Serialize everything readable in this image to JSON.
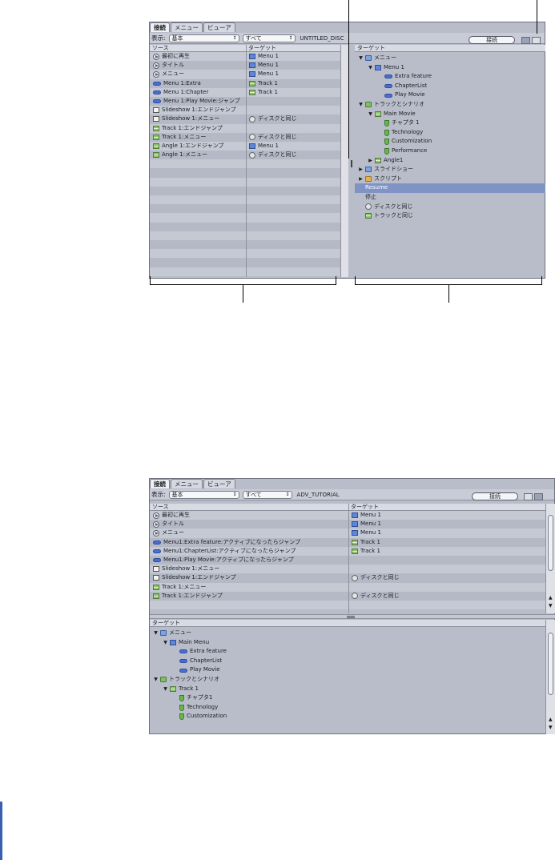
{
  "panel1": {
    "tabs": [
      "接続",
      "メニュー",
      "ビューア"
    ],
    "show_label": "表示:",
    "popup_basic": "基本",
    "popup_all": "すべて",
    "disc_name": "UNTITLED_DISC",
    "connect_button": "接続",
    "source_header": "ソース",
    "target_header": "ターゲット",
    "rows": [
      {
        "src_icon": "play",
        "src": "最初に再生",
        "tgt_icon": "menu",
        "tgt": "Menu 1"
      },
      {
        "src_icon": "play",
        "src": "タイトル",
        "tgt_icon": "menu",
        "tgt": "Menu 1"
      },
      {
        "src_icon": "play",
        "src": "メニュー",
        "tgt_icon": "menu",
        "tgt": "Menu 1"
      },
      {
        "src_icon": "btn",
        "src": "Menu 1:Extra",
        "tgt_icon": "track",
        "tgt": "Track 1"
      },
      {
        "src_icon": "btn",
        "src": "Menu 1:Chapter",
        "tgt_icon": "track",
        "tgt": "Track 1"
      },
      {
        "src_icon": "btn",
        "src": "Menu 1:Play Movie:ジャンプ",
        "tgt_icon": "",
        "tgt": ""
      },
      {
        "src_icon": "slide",
        "src": "Slideshow 1:エンドジャンプ",
        "tgt_icon": "",
        "tgt": ""
      },
      {
        "src_icon": "slide",
        "src": "Slideshow 1:メニュー",
        "tgt_icon": "disc",
        "tgt": "ディスクと同じ"
      },
      {
        "src_icon": "track",
        "src": "Track 1:エンドジャンプ",
        "tgt_icon": "",
        "tgt": ""
      },
      {
        "src_icon": "track",
        "src": "Track 1:メニュー",
        "tgt_icon": "disc",
        "tgt": "ディスクと同じ"
      },
      {
        "src_icon": "track",
        "src": "Angle 1:エンドジャンプ",
        "tgt_icon": "menu",
        "tgt": "Menu 1"
      },
      {
        "src_icon": "track",
        "src": "Angle 1:メニュー",
        "tgt_icon": "disc",
        "tgt": "ディスクと同じ"
      }
    ],
    "target_pane_header": "ターゲット",
    "tree": [
      {
        "indent": 0,
        "tri": "down",
        "icon": "folder-b",
        "label": "メニュー"
      },
      {
        "indent": 1,
        "tri": "down",
        "icon": "menu",
        "label": "Menu 1"
      },
      {
        "indent": 2,
        "tri": "",
        "icon": "btn",
        "label": "Extra feature"
      },
      {
        "indent": 2,
        "tri": "",
        "icon": "btn",
        "label": "ChapterList"
      },
      {
        "indent": 2,
        "tri": "",
        "icon": "btn",
        "label": "Play Movie"
      },
      {
        "indent": 0,
        "tri": "down",
        "icon": "folder-g",
        "label": "トラックとシナリオ"
      },
      {
        "indent": 1,
        "tri": "down",
        "icon": "track",
        "label": "Main Movie"
      },
      {
        "indent": 2,
        "tri": "",
        "icon": "chap",
        "label": "チャプタ 1"
      },
      {
        "indent": 2,
        "tri": "",
        "icon": "chap",
        "label": "Technology"
      },
      {
        "indent": 2,
        "tri": "",
        "icon": "chap",
        "label": "Customization"
      },
      {
        "indent": 2,
        "tri": "",
        "icon": "chap",
        "label": "Performance"
      },
      {
        "indent": 1,
        "tri": "right",
        "icon": "track",
        "label": "Angle1"
      },
      {
        "indent": 0,
        "tri": "right",
        "icon": "folder-b",
        "label": "スライドショー"
      },
      {
        "indent": 0,
        "tri": "right",
        "icon": "folder-o",
        "label": "スクリプト"
      },
      {
        "indent": 0,
        "tri": "",
        "icon": "",
        "label": "Resume",
        "selected": true
      },
      {
        "indent": 0,
        "tri": "",
        "icon": "",
        "label": "停止"
      },
      {
        "indent": 0,
        "tri": "",
        "icon": "disc",
        "label": "ディスクと同じ"
      },
      {
        "indent": 0,
        "tri": "",
        "icon": "track",
        "label": "トラックと同じ"
      }
    ]
  },
  "panel2": {
    "tabs": [
      "接続",
      "メニュー",
      "ビューア"
    ],
    "show_label": "表示:",
    "popup_basic": "基本",
    "popup_all": "すべて",
    "disc_name": "ADV_TUTORIAL",
    "connect_button": "接続",
    "source_header": "ソース",
    "target_header": "ターゲット",
    "rows": [
      {
        "src_icon": "play",
        "src": "最初に再生",
        "tgt_icon": "menu",
        "tgt": "Menu 1"
      },
      {
        "src_icon": "play",
        "src": "タイトル",
        "tgt_icon": "menu",
        "tgt": "Menu 1"
      },
      {
        "src_icon": "play",
        "src": "メニュー",
        "tgt_icon": "menu",
        "tgt": "Menu 1"
      },
      {
        "src_icon": "btn",
        "src": "Menu1:Extra feature:アクティブになったらジャンプ",
        "tgt_icon": "track",
        "tgt": "Track 1"
      },
      {
        "src_icon": "btn",
        "src": "Menu1:ChapterList:アクティブになったらジャンプ",
        "tgt_icon": "track",
        "tgt": "Track 1"
      },
      {
        "src_icon": "btn",
        "src": "Menu1:Play Movie:アクティブになったらジャンプ",
        "tgt_icon": "",
        "tgt": ""
      },
      {
        "src_icon": "slide",
        "src": "Slideshow 1:メニュー",
        "tgt_icon": "",
        "tgt": ""
      },
      {
        "src_icon": "slide",
        "src": "Slideshow 1:エンドジャンプ",
        "tgt_icon": "disc",
        "tgt": "ディスクと同じ"
      },
      {
        "src_icon": "track",
        "src": "Track 1:メニュー",
        "tgt_icon": "",
        "tgt": ""
      },
      {
        "src_icon": "track",
        "src": "Track 1:エンドジャンプ",
        "tgt_icon": "disc",
        "tgt": "ディスクと同じ"
      }
    ],
    "target_pane_header": "ターゲット",
    "tree": [
      {
        "indent": 0,
        "tri": "down",
        "icon": "folder-b",
        "label": "メニュー"
      },
      {
        "indent": 1,
        "tri": "down",
        "icon": "menu",
        "label": "Main Menu"
      },
      {
        "indent": 2,
        "tri": "",
        "icon": "btn",
        "label": "Extra feature"
      },
      {
        "indent": 2,
        "tri": "",
        "icon": "btn",
        "label": "ChapterList"
      },
      {
        "indent": 2,
        "tri": "",
        "icon": "btn",
        "label": "Play Movie"
      },
      {
        "indent": 0,
        "tri": "down",
        "icon": "folder-g",
        "label": "トラックとシナリオ"
      },
      {
        "indent": 1,
        "tri": "down",
        "icon": "track",
        "label": "Track 1"
      },
      {
        "indent": 2,
        "tri": "",
        "icon": "chap",
        "label": "チャプタ1"
      },
      {
        "indent": 2,
        "tri": "",
        "icon": "chap",
        "label": "Technology"
      },
      {
        "indent": 2,
        "tri": "",
        "icon": "chap",
        "label": "Customization"
      }
    ]
  }
}
